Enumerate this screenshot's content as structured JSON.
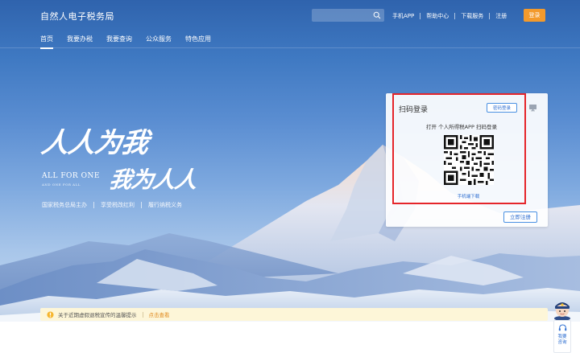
{
  "header": {
    "site_title": "自然人电子税务局",
    "search_placeholder": "",
    "top_links": [
      "手机APP",
      "帮助中心",
      "下载服务",
      "注册"
    ],
    "login_label": "登录"
  },
  "nav": {
    "items": [
      "首页",
      "我要办税",
      "我要查询",
      "公众服务",
      "特色应用"
    ],
    "active_index": 0
  },
  "slogan": {
    "calligraphy_line1": "人人为我",
    "calligraphy_line2": "我为人人",
    "english_line1": "ALL FOR ONE",
    "english_line2": "AND ONE FOR ALL",
    "tags": [
      "国家税务总局主办",
      "享受税改红利",
      "履行纳税义务"
    ]
  },
  "login_card": {
    "title": "扫码登录",
    "password_login_label": "密码登录",
    "scan_instruction": "打开 个人所得税APP 扫码登录",
    "download_link": "手机端下载",
    "register_label": "立即注册"
  },
  "notice": {
    "text": "关于近期虚假退税宣传的温馨提示",
    "link": "点击查看"
  },
  "assistant": {
    "label_line1": "我要",
    "label_line2": "咨询"
  },
  "colors": {
    "accent_orange": "#f39a2c",
    "link_blue": "#2f6fd1",
    "highlight_red": "#e5252a",
    "notice_bg": "#fdf6d8"
  }
}
